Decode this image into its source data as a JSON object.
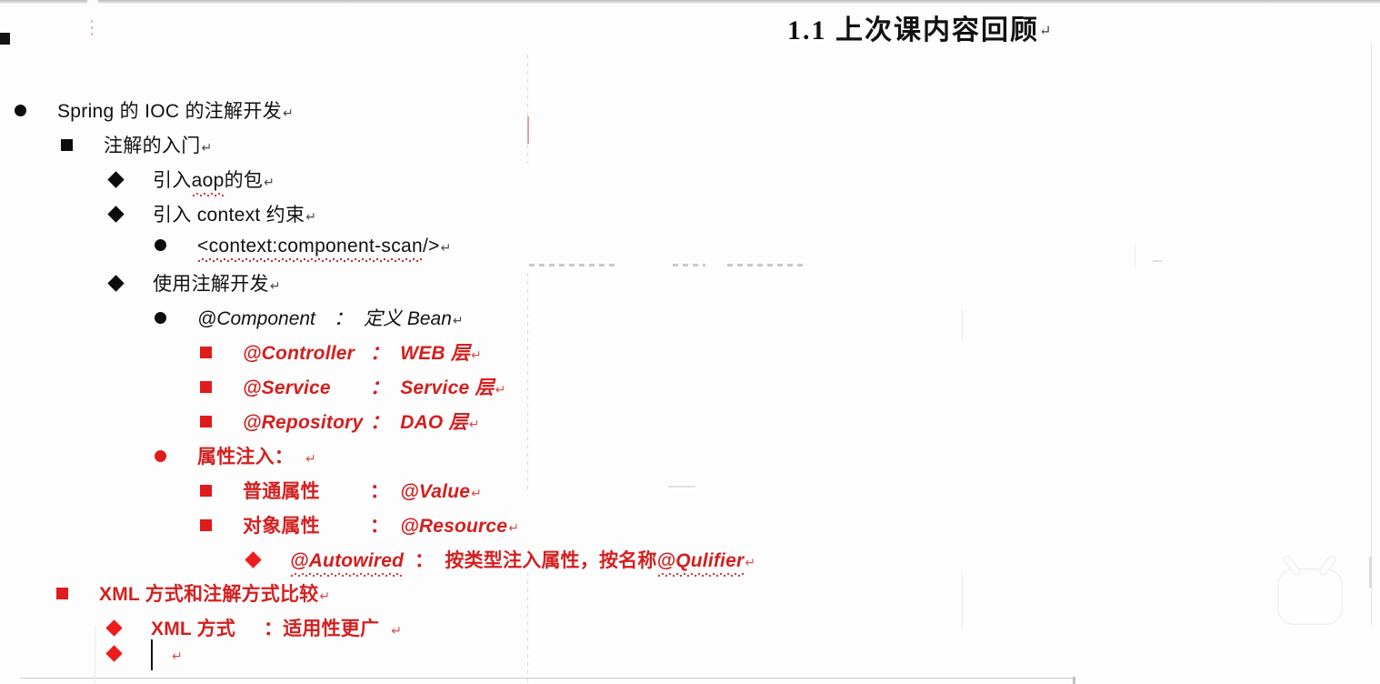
{
  "document": {
    "heading": "1.1 上次课内容回顾",
    "pilcrow": "↵"
  },
  "outline": [
    {
      "id": "spring-ioc-annotation",
      "level": 1,
      "bullet": "disc",
      "color": "black",
      "text": "Spring 的 IOC 的注解开发",
      "pilcrow": "↵"
    },
    {
      "id": "annotation-intro",
      "level": 2,
      "bullet": "square",
      "color": "black",
      "text": "注解的入门",
      "pilcrow": "↵"
    },
    {
      "id": "import-aop-package",
      "level": 3,
      "bullet": "diamond",
      "color": "black",
      "text_before": "引入 ",
      "text_underlined": "aop",
      "text_after": " 的包",
      "pilcrow": "↵"
    },
    {
      "id": "import-context-schema",
      "level": 3,
      "bullet": "diamond",
      "color": "black",
      "text": "引入 context 约束",
      "pilcrow": "↵"
    },
    {
      "id": "component-scan-tag",
      "level": 4,
      "bullet": "disc",
      "color": "black",
      "text_underlined": "<context:component-scan",
      "text_after": " />",
      "pilcrow": "↵"
    },
    {
      "id": "use-annotation-dev",
      "level": 3,
      "bullet": "diamond",
      "color": "black",
      "text": "使用注解开发",
      "pilcrow": "↵"
    },
    {
      "id": "at-component",
      "level": 4,
      "bullet": "disc",
      "color": "black",
      "style": "italic",
      "term": "@Component",
      "separator": "：",
      "desc": "定义 Bean",
      "pilcrow": "↵"
    },
    {
      "id": "at-controller",
      "level": 5,
      "bullet": "square",
      "color": "red",
      "term": "@Controller",
      "separator": "：",
      "desc": "WEB 层",
      "pilcrow": "↵"
    },
    {
      "id": "at-service",
      "level": 5,
      "bullet": "square",
      "color": "red",
      "term": "@Service",
      "separator": "：",
      "desc": "Service 层",
      "pilcrow": "↵"
    },
    {
      "id": "at-repository",
      "level": 5,
      "bullet": "square",
      "color": "red",
      "term": "@Repository",
      "separator": "：",
      "desc": "DAO 层",
      "pilcrow": "↵"
    },
    {
      "id": "property-injection",
      "level": 4,
      "bullet": "disc",
      "color": "red",
      "text": "属性注入：",
      "pilcrow": "↵"
    },
    {
      "id": "simple-property",
      "level": 5,
      "bullet": "square",
      "color": "red",
      "term": "普通属性",
      "separator": "：",
      "desc": "@Value",
      "pilcrow": "↵"
    },
    {
      "id": "object-property",
      "level": 5,
      "bullet": "square",
      "color": "red",
      "term": "对象属性",
      "separator": "：",
      "desc": "@Resource",
      "pilcrow": "↵"
    },
    {
      "id": "at-autowired",
      "level": 6,
      "bullet": "diamond",
      "color": "red",
      "term_underlined": "@Autowired",
      "separator": "：",
      "desc_before": "按类型注入属性，按名称",
      "desc_underlined": "@Qulifier",
      "pilcrow": "↵"
    },
    {
      "id": "xml-vs-annotation",
      "level": 2,
      "bullet": "square",
      "color": "red",
      "text": "XML 方式和注解方式比较",
      "pilcrow": "↵"
    },
    {
      "id": "xml-approach",
      "level": 3,
      "bullet": "diamond",
      "color": "red",
      "term": "XML 方式",
      "separator": "：",
      "desc": "适用性更广",
      "pilcrow": "↵"
    },
    {
      "id": "empty-new-item",
      "level": 3,
      "bullet": "diamond",
      "color": "red",
      "text": "",
      "pilcrow": "↵"
    }
  ],
  "watermark": {
    "name": "bilibili-tv-play-logo",
    "color": "#ffffff"
  }
}
